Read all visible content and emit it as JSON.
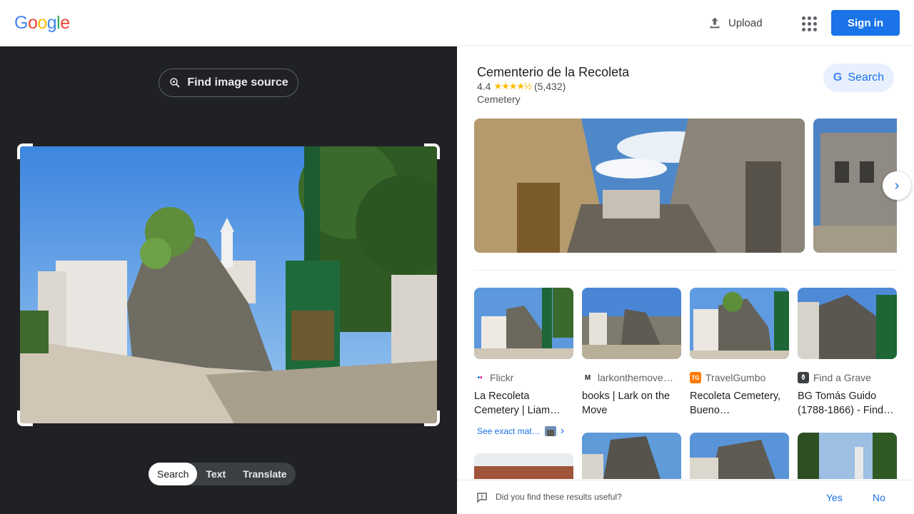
{
  "header": {
    "logo_letters": [
      "G",
      "o",
      "o",
      "g",
      "l",
      "e"
    ],
    "logo_colors": [
      "#4285f4",
      "#ea4335",
      "#fbbc05",
      "#4285f4",
      "#34a853",
      "#ea4335"
    ],
    "upload_label": "Upload",
    "signin_label": "Sign in"
  },
  "lens": {
    "find_source_label": "Find image source",
    "modes": [
      "Search",
      "Text",
      "Translate"
    ],
    "active_mode": "Search"
  },
  "knowledge_panel": {
    "title": "Cementerio de la Recoleta",
    "rating": "4.4",
    "stars": "★★★★½",
    "reviews": "(5,432)",
    "type": "Cemetery",
    "search_label": "Search",
    "search_letter": "G"
  },
  "results": [
    {
      "source": "Flickr",
      "title": "La Recoleta Cemetery | Liam…",
      "favicon_text": "••",
      "favicon_color": "#ff0084"
    },
    {
      "source": "larkonthemove…",
      "title": "books | Lark on the Move",
      "favicon_text": "M",
      "favicon_color": "#202124"
    },
    {
      "source": "TravelGumbo",
      "title": "Recoleta Cemetery, Bueno…",
      "favicon_text": "TG",
      "favicon_color": "#ff7a00"
    },
    {
      "source": "Find a Grave",
      "title": "BG Tomás Guido (1788-1866) - Find…",
      "favicon_text": "⚱",
      "favicon_color": "#3c4043"
    }
  ],
  "see_exact": "See exact mat…",
  "feedback": {
    "question": "Did you find these results useful?",
    "yes": "Yes",
    "no": "No"
  },
  "icons": [
    "upload-icon",
    "apps-grid-icon",
    "lens-search-icon",
    "chevron-right-icon",
    "feedback-icon"
  ]
}
